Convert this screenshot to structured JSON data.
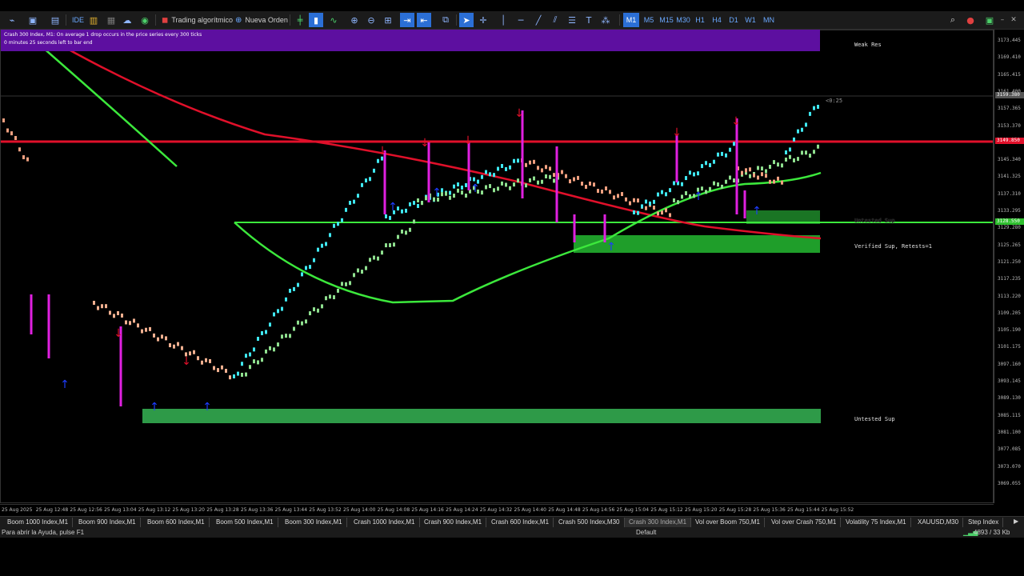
{
  "toolbar": {
    "algo_label": "Trading algorítmico",
    "new_order_label": "Nueva Orden",
    "ide_label": "IDE",
    "timeframes": [
      "M1",
      "M5",
      "M15",
      "M30",
      "H1",
      "H4",
      "D1",
      "W1",
      "MN"
    ],
    "active_timeframe": "M1"
  },
  "chart": {
    "symbol_info": "Crash 300 Index, M1:  On average 1 drop occurs in the price series every 300 ticks",
    "countdown_info": "0 minutes 25 seconds left to bar end",
    "bar_timer": "<0:25",
    "zones": {
      "weak_res": "Weak Res",
      "untested_sup_upper": "Untested Sup",
      "verified_sup": "Verified Sup, Retests=1",
      "untested_sup_lower": "Untested Sup"
    },
    "price_labels": [
      "3173.445",
      "3169.410",
      "3165.415",
      "3161.400",
      "3157.365",
      "3153.370",
      "3149.330",
      "3145.340",
      "3141.325",
      "3137.310",
      "3133.295",
      "3129.280",
      "3125.265",
      "3121.250",
      "3117.235",
      "3113.220",
      "3109.205",
      "3105.190",
      "3101.175",
      "3097.160",
      "3093.145",
      "3089.130",
      "3085.115",
      "3081.100",
      "3077.085",
      "3073.070",
      "3069.055"
    ],
    "price_badges": {
      "current": "3159.380",
      "red_line": "3149.850",
      "green_line": "3128.550"
    },
    "time_labels": [
      "25 Aug 2025",
      "25 Aug 12:48",
      "25 Aug 12:56",
      "25 Aug 13:04",
      "25 Aug 13:12",
      "25 Aug 13:20",
      "25 Aug 13:28",
      "25 Aug 13:36",
      "25 Aug 13:44",
      "25 Aug 13:52",
      "25 Aug 14:00",
      "25 Aug 14:08",
      "25 Aug 14:16",
      "25 Aug 14:24",
      "25 Aug 14:32",
      "25 Aug 14:40",
      "25 Aug 14:48",
      "25 Aug 14:56",
      "25 Aug 15:04",
      "25 Aug 15:12",
      "25 Aug 15:20",
      "25 Aug 15:28",
      "25 Aug 15:36",
      "25 Aug 15:44",
      "25 Aug 15:52"
    ]
  },
  "tabs": [
    {
      "label": "Boom 1000 Index,M1",
      "active": false
    },
    {
      "label": "Boom 900 Index,M1",
      "active": false
    },
    {
      "label": "Boom 600 Index,M1",
      "active": false
    },
    {
      "label": "Boom 500 Index,M1",
      "active": false
    },
    {
      "label": "Boom 300 Index,M1",
      "active": false
    },
    {
      "label": "Crash 1000 Index,M1",
      "active": false
    },
    {
      "label": "Crash 900 Index,M1",
      "active": false
    },
    {
      "label": "Crash 600 Index,M1",
      "active": false
    },
    {
      "label": "Crash 500 Index,M30",
      "active": false
    },
    {
      "label": "Crash 300 Index,M1",
      "active": true
    },
    {
      "label": "Vol over Boom 750,M1",
      "active": false
    },
    {
      "label": "Vol over Crash 750,M1",
      "active": false
    },
    {
      "label": "Volatility 75 Index,M1",
      "active": false
    },
    {
      "label": "XAUUSD,M30",
      "active": false
    },
    {
      "label": "Step Index",
      "active": false
    }
  ],
  "status": {
    "help": "Para abrir la Ayuda, pulse F1",
    "profile": "Default",
    "traffic": "4893 / 33 Kb"
  },
  "colors": {
    "red_line": "#e0102a",
    "green_line": "#3ce83c",
    "zone_green": "#1f9e2a",
    "banner": "#5d0fa0",
    "cyan": "#40e8f0",
    "magenta": "#e020e0"
  }
}
